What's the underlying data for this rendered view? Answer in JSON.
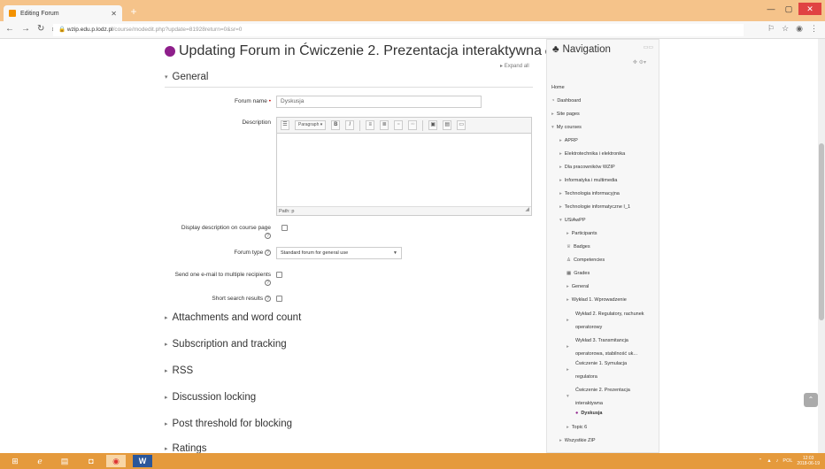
{
  "browser": {
    "tab_title": "Editing Forum",
    "url_host": "wzip.edu.p.lodz.pl",
    "url_path": "/course/modedit.php?update=81928return=0&sr=0",
    "icons": [
      "back-icon",
      "forward-icon",
      "reload-icon",
      "home-icon",
      "lock-icon",
      "translate-icon",
      "star-icon",
      "account-icon",
      "menu-icon"
    ]
  },
  "page": {
    "title": "Updating Forum in Ćwiczenie 2. Prezentacja interaktywna",
    "expand_all": "Expand all"
  },
  "general": {
    "heading": "General",
    "forum_name_label": "Forum name",
    "forum_name_value": "Dyskusja",
    "description_label": "Description",
    "editor": {
      "paragraph": "Paragraph",
      "bold": "B",
      "italic": "I",
      "path": "Path: p"
    },
    "display_description_label": "Display description on course page",
    "forum_type_label": "Forum type",
    "forum_type_value": "Standard forum for general use",
    "send_email_label": "Send one e-mail to multiple recipients",
    "short_search_label": "Short search results"
  },
  "sections": [
    "Attachments and word count",
    "Subscription and tracking",
    "RSS",
    "Discussion locking",
    "Post threshold for blocking",
    "Ratings"
  ],
  "navigation": {
    "heading": "Navigation",
    "home": "Home",
    "dashboard": "Dashboard",
    "site_pages": "Site pages",
    "my_courses": "My courses",
    "courses": [
      "APRP",
      "Elektrotechnika i elektronika",
      "Dla pracowników WZIP",
      "Informatyka i multimedia",
      "Technologia informacyjna",
      "Technologie informatyczne I_1",
      "USiAwPP"
    ],
    "course_items": [
      "Participants",
      "Badges",
      "Competencies",
      "Grades",
      "General"
    ],
    "wyklad1": "Wykład 1. Wprowadzenie",
    "wyklad2_a": "Wykład 2. Regulatory, rachunek",
    "wyklad2_b": "operatorowy",
    "wyklad3_a": "Wykład 3. Transmitancja",
    "wyklad3_b": "operatorowa, stabilność uk...",
    "cw1_a": "Ćwiczenie 1. Symulacja",
    "cw1_b": "regulatora",
    "cw2_a": "Ćwiczenie 2. Prezentacja",
    "cw2_b": "interaktywna",
    "dyskusja": "Dyskusja",
    "topic6": "Topic 6",
    "wszystkie": "Wszystkie ZIP"
  },
  "taskbar": {
    "lang": "POL",
    "time": "12:03",
    "date": "2018-06-19"
  },
  "colors": {
    "forum_icon": "#8e1f8b",
    "link": "#1177d1",
    "taskbar": "#e59a3c",
    "titlebar": "#f5c38a"
  }
}
